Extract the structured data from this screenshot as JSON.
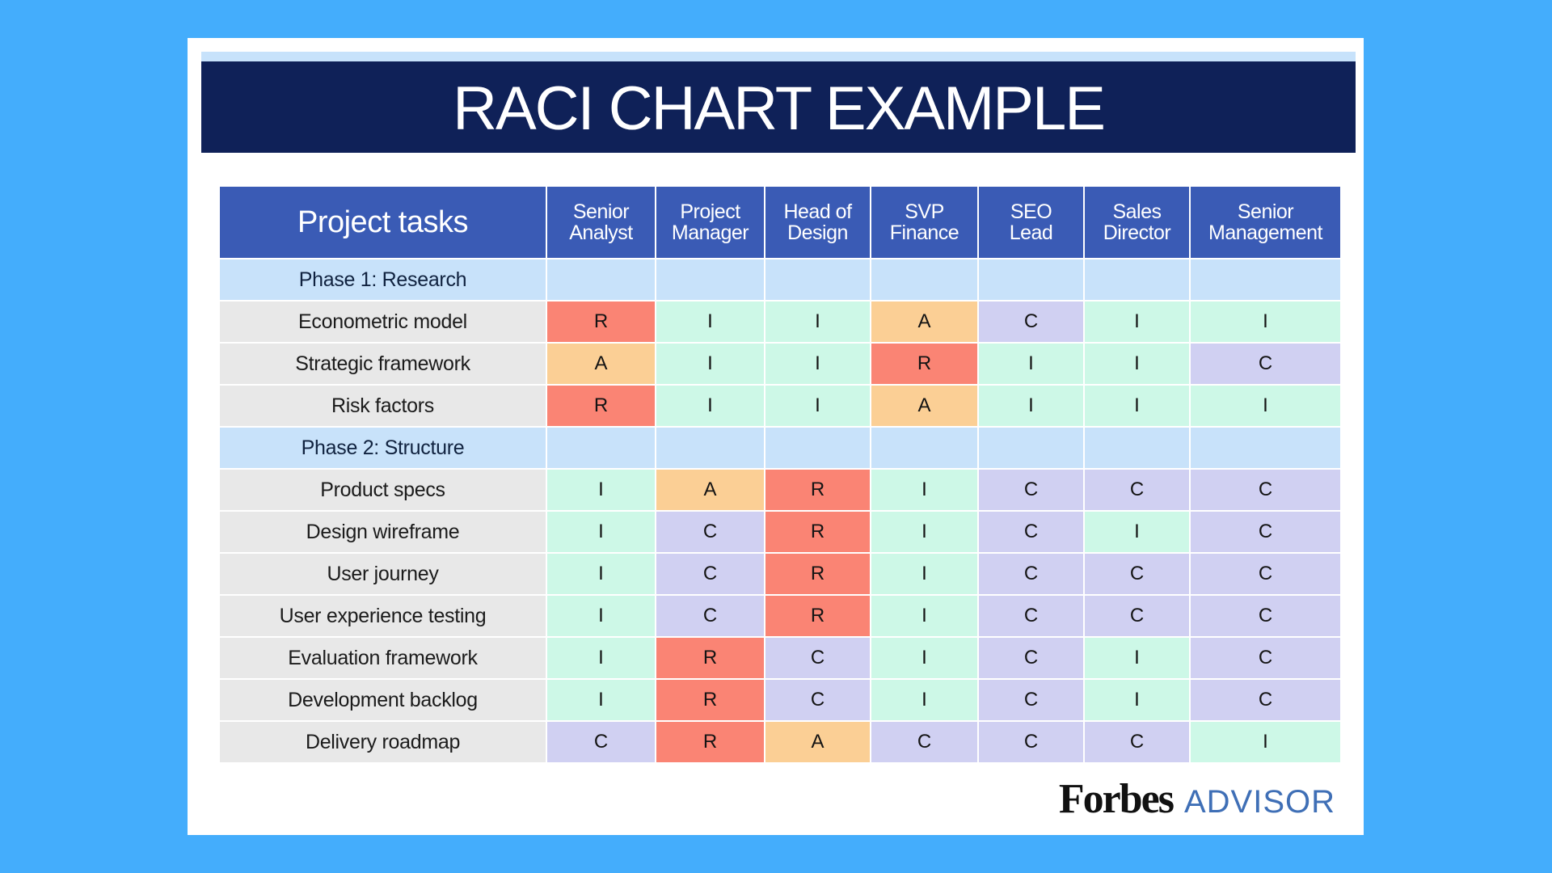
{
  "title": "RACI CHART EXAMPLE",
  "colors": {
    "background": "#44adfc",
    "title_band": "#0f2158",
    "header": "#3a5bb5",
    "phase_row": "#c8e2fa",
    "task_cell": "#e8e8e8",
    "R": "#fa8474",
    "A": "#fbcf95",
    "I": "#cdf8e7",
    "C": "#d0d0f2"
  },
  "branding": {
    "forbes": "Forbes",
    "advisor": "ADVISOR"
  },
  "chart_data": {
    "type": "table",
    "title": "RACI CHART EXAMPLE",
    "task_header": "Project tasks",
    "roles": [
      [
        "Senior",
        "Analyst"
      ],
      [
        "Project",
        "Manager"
      ],
      [
        "Head of",
        "Design"
      ],
      [
        "SVP",
        "Finance"
      ],
      [
        "SEO",
        "Lead"
      ],
      [
        "Sales",
        "Director"
      ],
      [
        "Senior",
        "Management"
      ]
    ],
    "phases": [
      {
        "name": "Phase 1: Research",
        "tasks": [
          {
            "task": "Econometric model",
            "values": [
              "R",
              "I",
              "I",
              "A",
              "C",
              "I",
              "I"
            ]
          },
          {
            "task": "Strategic framework",
            "values": [
              "A",
              "I",
              "I",
              "R",
              "I",
              "I",
              "C"
            ]
          },
          {
            "task": "Risk factors",
            "values": [
              "R",
              "I",
              "I",
              "A",
              "I",
              "I",
              "I"
            ]
          }
        ]
      },
      {
        "name": "Phase 2: Structure",
        "tasks": [
          {
            "task": "Product specs",
            "values": [
              "I",
              "A",
              "R",
              "I",
              "C",
              "C",
              "C"
            ]
          },
          {
            "task": "Design wireframe",
            "values": [
              "I",
              "C",
              "R",
              "I",
              "C",
              "I",
              "C"
            ]
          },
          {
            "task": "User journey",
            "values": [
              "I",
              "C",
              "R",
              "I",
              "C",
              "C",
              "C"
            ]
          },
          {
            "task": "User experience testing",
            "values": [
              "I",
              "C",
              "R",
              "I",
              "C",
              "C",
              "C"
            ]
          },
          {
            "task": "Evaluation framework",
            "values": [
              "I",
              "R",
              "C",
              "I",
              "C",
              "I",
              "C"
            ]
          },
          {
            "task": "Development backlog",
            "values": [
              "I",
              "R",
              "C",
              "I",
              "C",
              "I",
              "C"
            ]
          },
          {
            "task": "Delivery roadmap",
            "values": [
              "C",
              "R",
              "A",
              "C",
              "C",
              "C",
              "I"
            ]
          }
        ]
      }
    ]
  }
}
